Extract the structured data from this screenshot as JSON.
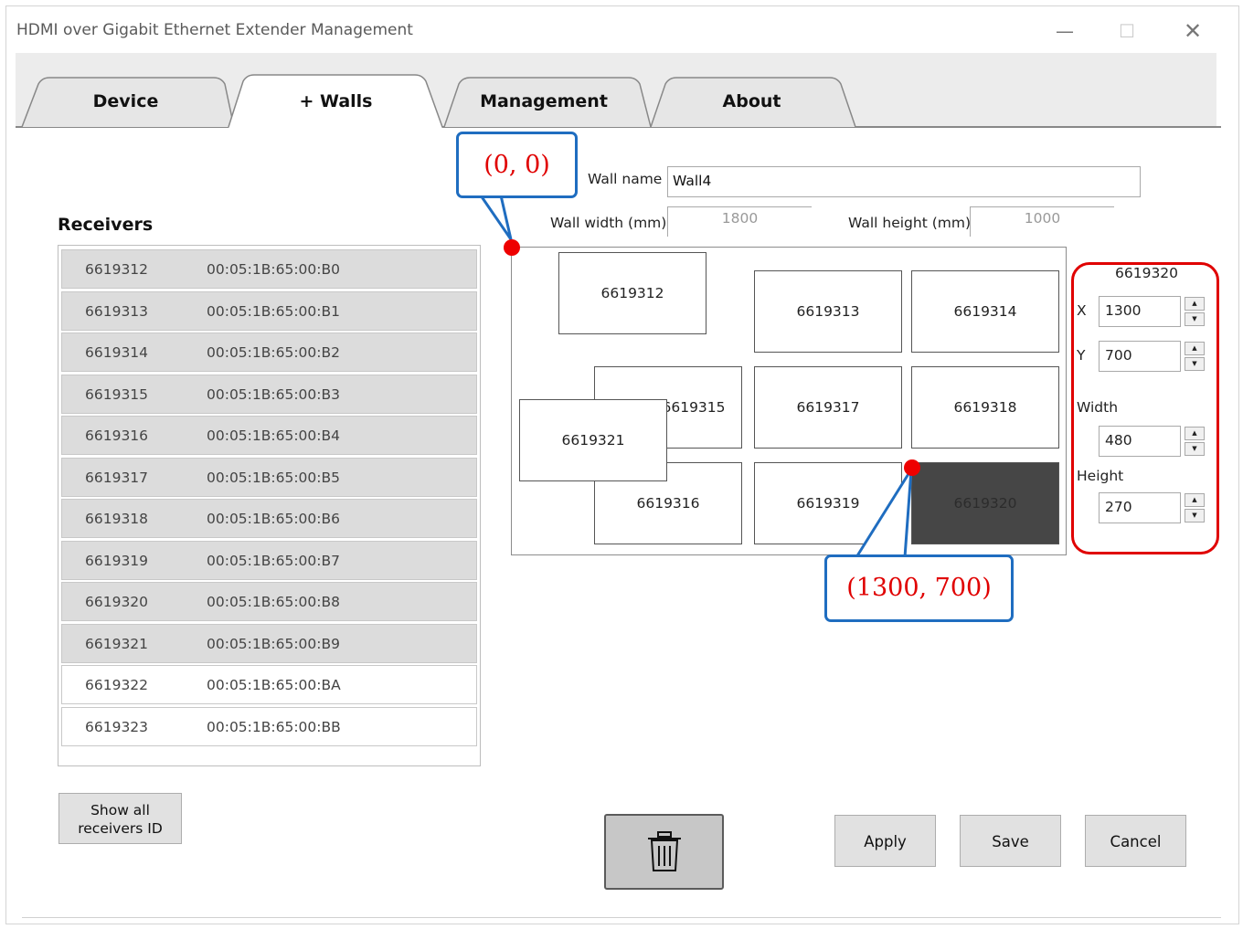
{
  "window": {
    "title": "HDMI over Gigabit Ethernet Extender Management",
    "minimize_glyph": "—",
    "maximize_glyph": "☐",
    "close_glyph": "✕"
  },
  "tabs": [
    {
      "label": "Device"
    },
    {
      "label": "+ Walls",
      "active": true
    },
    {
      "label": "Management"
    },
    {
      "label": "About"
    }
  ],
  "receivers": {
    "title": "Receivers",
    "rows": [
      {
        "id": "6619312",
        "mac": "00:05:1B:65:00:B0",
        "assigned": true
      },
      {
        "id": "6619313",
        "mac": "00:05:1B:65:00:B1",
        "assigned": true
      },
      {
        "id": "6619314",
        "mac": "00:05:1B:65:00:B2",
        "assigned": true
      },
      {
        "id": "6619315",
        "mac": "00:05:1B:65:00:B3",
        "assigned": true
      },
      {
        "id": "6619316",
        "mac": "00:05:1B:65:00:B4",
        "assigned": true
      },
      {
        "id": "6619317",
        "mac": "00:05:1B:65:00:B5",
        "assigned": true
      },
      {
        "id": "6619318",
        "mac": "00:05:1B:65:00:B6",
        "assigned": true
      },
      {
        "id": "6619319",
        "mac": "00:05:1B:65:00:B7",
        "assigned": true
      },
      {
        "id": "6619320",
        "mac": "00:05:1B:65:00:B8",
        "assigned": true
      },
      {
        "id": "6619321",
        "mac": "00:05:1B:65:00:B9",
        "assigned": true
      },
      {
        "id": "6619322",
        "mac": "00:05:1B:65:00:BA",
        "assigned": false
      },
      {
        "id": "6619323",
        "mac": "00:05:1B:65:00:BB",
        "assigned": false
      }
    ],
    "show_all_label_line1": "Show all",
    "show_all_label_line2": "receivers ID"
  },
  "wall": {
    "name_label": "Wall name",
    "name_value": "Wall4",
    "width_label": "Wall width (mm)",
    "width_value": "1800",
    "height_label": "Wall height (mm)",
    "height_value": "1000"
  },
  "wall_screens": [
    {
      "id": "6619312"
    },
    {
      "id": "6619313"
    },
    {
      "id": "6619314"
    },
    {
      "id": "6619315"
    },
    {
      "id": "6619317"
    },
    {
      "id": "6619318"
    },
    {
      "id": "6619321"
    },
    {
      "id": "6619316"
    },
    {
      "id": "6619319"
    },
    {
      "id": "6619320",
      "selected": true
    }
  ],
  "selected_receiver": {
    "id": "6619320",
    "x_label": "X",
    "x_value": "1300",
    "y_label": "Y",
    "y_value": "700",
    "width_label": "Width",
    "width_value": "480",
    "height_label": "Height",
    "height_value": "270"
  },
  "annotations": {
    "origin": "(0, 0)",
    "position": "(1300, 700)",
    "callout_border_color": "#1f6dc0",
    "marker_color": "#ee0000"
  },
  "buttons": {
    "delete_icon": "trash-icon",
    "apply": "Apply",
    "save": "Save",
    "cancel": "Cancel"
  },
  "colors": {
    "selected_screen": "#464646",
    "assigned_row": "#dcdcdc",
    "highlight_box": "#e00000"
  }
}
